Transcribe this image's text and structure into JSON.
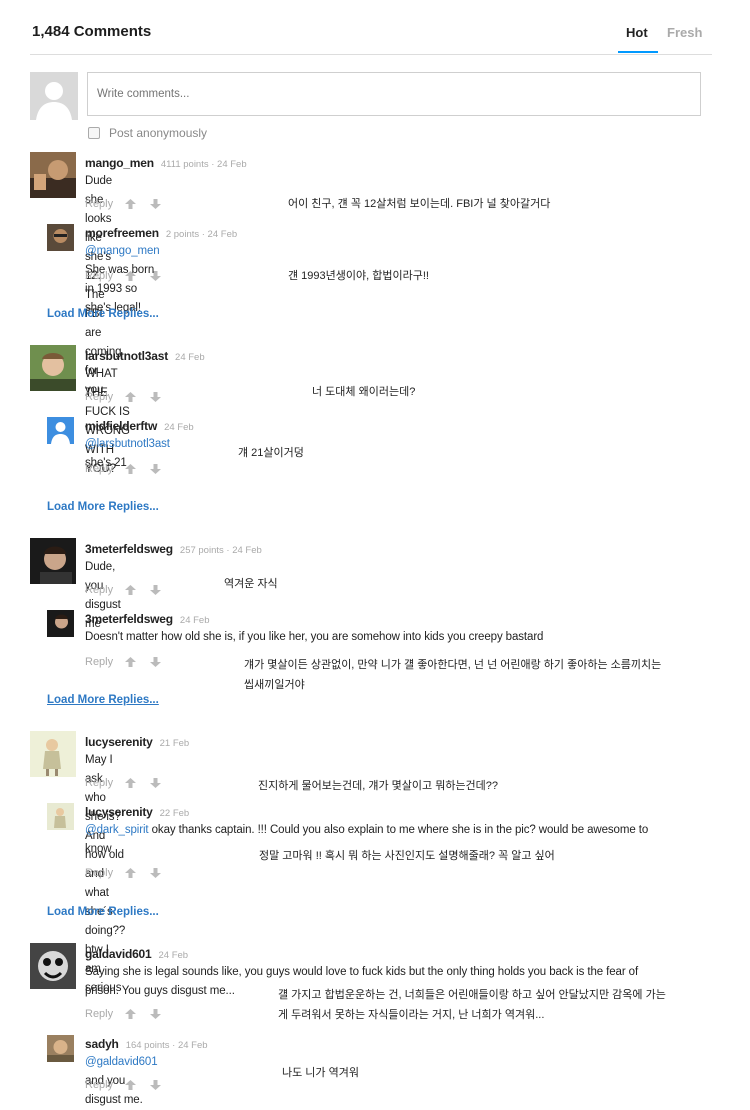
{
  "header": {
    "title": "1,484 Comments",
    "tab_hot": "Hot",
    "tab_fresh": "Fresh"
  },
  "compose": {
    "placeholder": "Write comments...",
    "anon_label": "Post anonymously"
  },
  "actions": {
    "reply": "Reply"
  },
  "load_more": "Load More Replies...",
  "comments": [
    {
      "user": "mango_men",
      "meta": "4111 points · 24 Feb",
      "text": "Dude she looks like she's 12. The FBI are coming for you.",
      "translation": "어이 친구, 걘 꼭 12살처럼 보이는데. FBI가 널 찾아갈거다"
    },
    {
      "user": "morefreemen",
      "meta": "2 points · 24 Feb",
      "mention": "@mango_men",
      "text": " She was born in 1993 so she's legal!",
      "translation": "걘 1993년생이야, 합법이라구!!"
    },
    {
      "user": "larsbutnotl3ast",
      "meta": "24 Feb",
      "text": "WHAT THE FUCK IS WRONG WITH YOU?",
      "translation": "너 도대체 왜이러는데?"
    },
    {
      "user": "midfielderftw",
      "meta": "24 Feb",
      "mention": "@larsbutnotl3ast",
      "text": " she's 21",
      "translation": "걔 21살이거덩"
    },
    {
      "user": "3meterfeldsweg",
      "meta": "257 points · 24 Feb",
      "text": "Dude, you disgust me",
      "translation": "역겨운 자식"
    },
    {
      "user": "3meterfeldsweg",
      "meta": "24 Feb",
      "text": "Doesn't matter how old she is, if you like her, you are somehow into kids you creepy bastard",
      "translation_line1": "걔가 몇살이든 상관없이, 만약 니가 걜 좋아한다면, 넌 넌 어린애랑 하기 좋아하는 소름끼치는",
      "translation_line2": "씹새끼일거야"
    },
    {
      "user": "lucyserenity",
      "meta": "21 Feb",
      "text": "May I ask who she is? And how old and what she´s doing?? btw I am serious",
      "translation": "진지하게 물어보는건데, 걔가 몇살이고 뭐하는건데??"
    },
    {
      "user": "lucyserenity",
      "meta": "22 Feb",
      "mention": "@dark_spirit",
      "text": " okay thanks captain. !!! Could you also explain to me where she is in the pic? would be awesome to",
      "text_line2": "know",
      "translation": "정말 고마워 !! 혹시 뭐 하는 사진인지도 설명해줄래? 꼭 알고 싶어"
    },
    {
      "user": "galdavid601",
      "meta": "24 Feb",
      "text": "Saying she is legal sounds like, you guys would love to fuck kids but the only thing holds you back is the fear of",
      "text_line2": "prison. You guys disgust me...",
      "translation_line1": "걜 가지고 합법운운하는 건, 너희들은 어린애들이랑 하고 싶어 안달났지만 감옥에 가는",
      "translation_line2": "게 두려워서 못하는 자식들이라는 거지, 난 너희가 역겨워..."
    },
    {
      "user": "sadyh",
      "meta": "164 points · 24 Feb",
      "mention": "@galdavid601",
      "text": " and you disgust me.",
      "translation": "나도 니가 역겨워"
    }
  ]
}
